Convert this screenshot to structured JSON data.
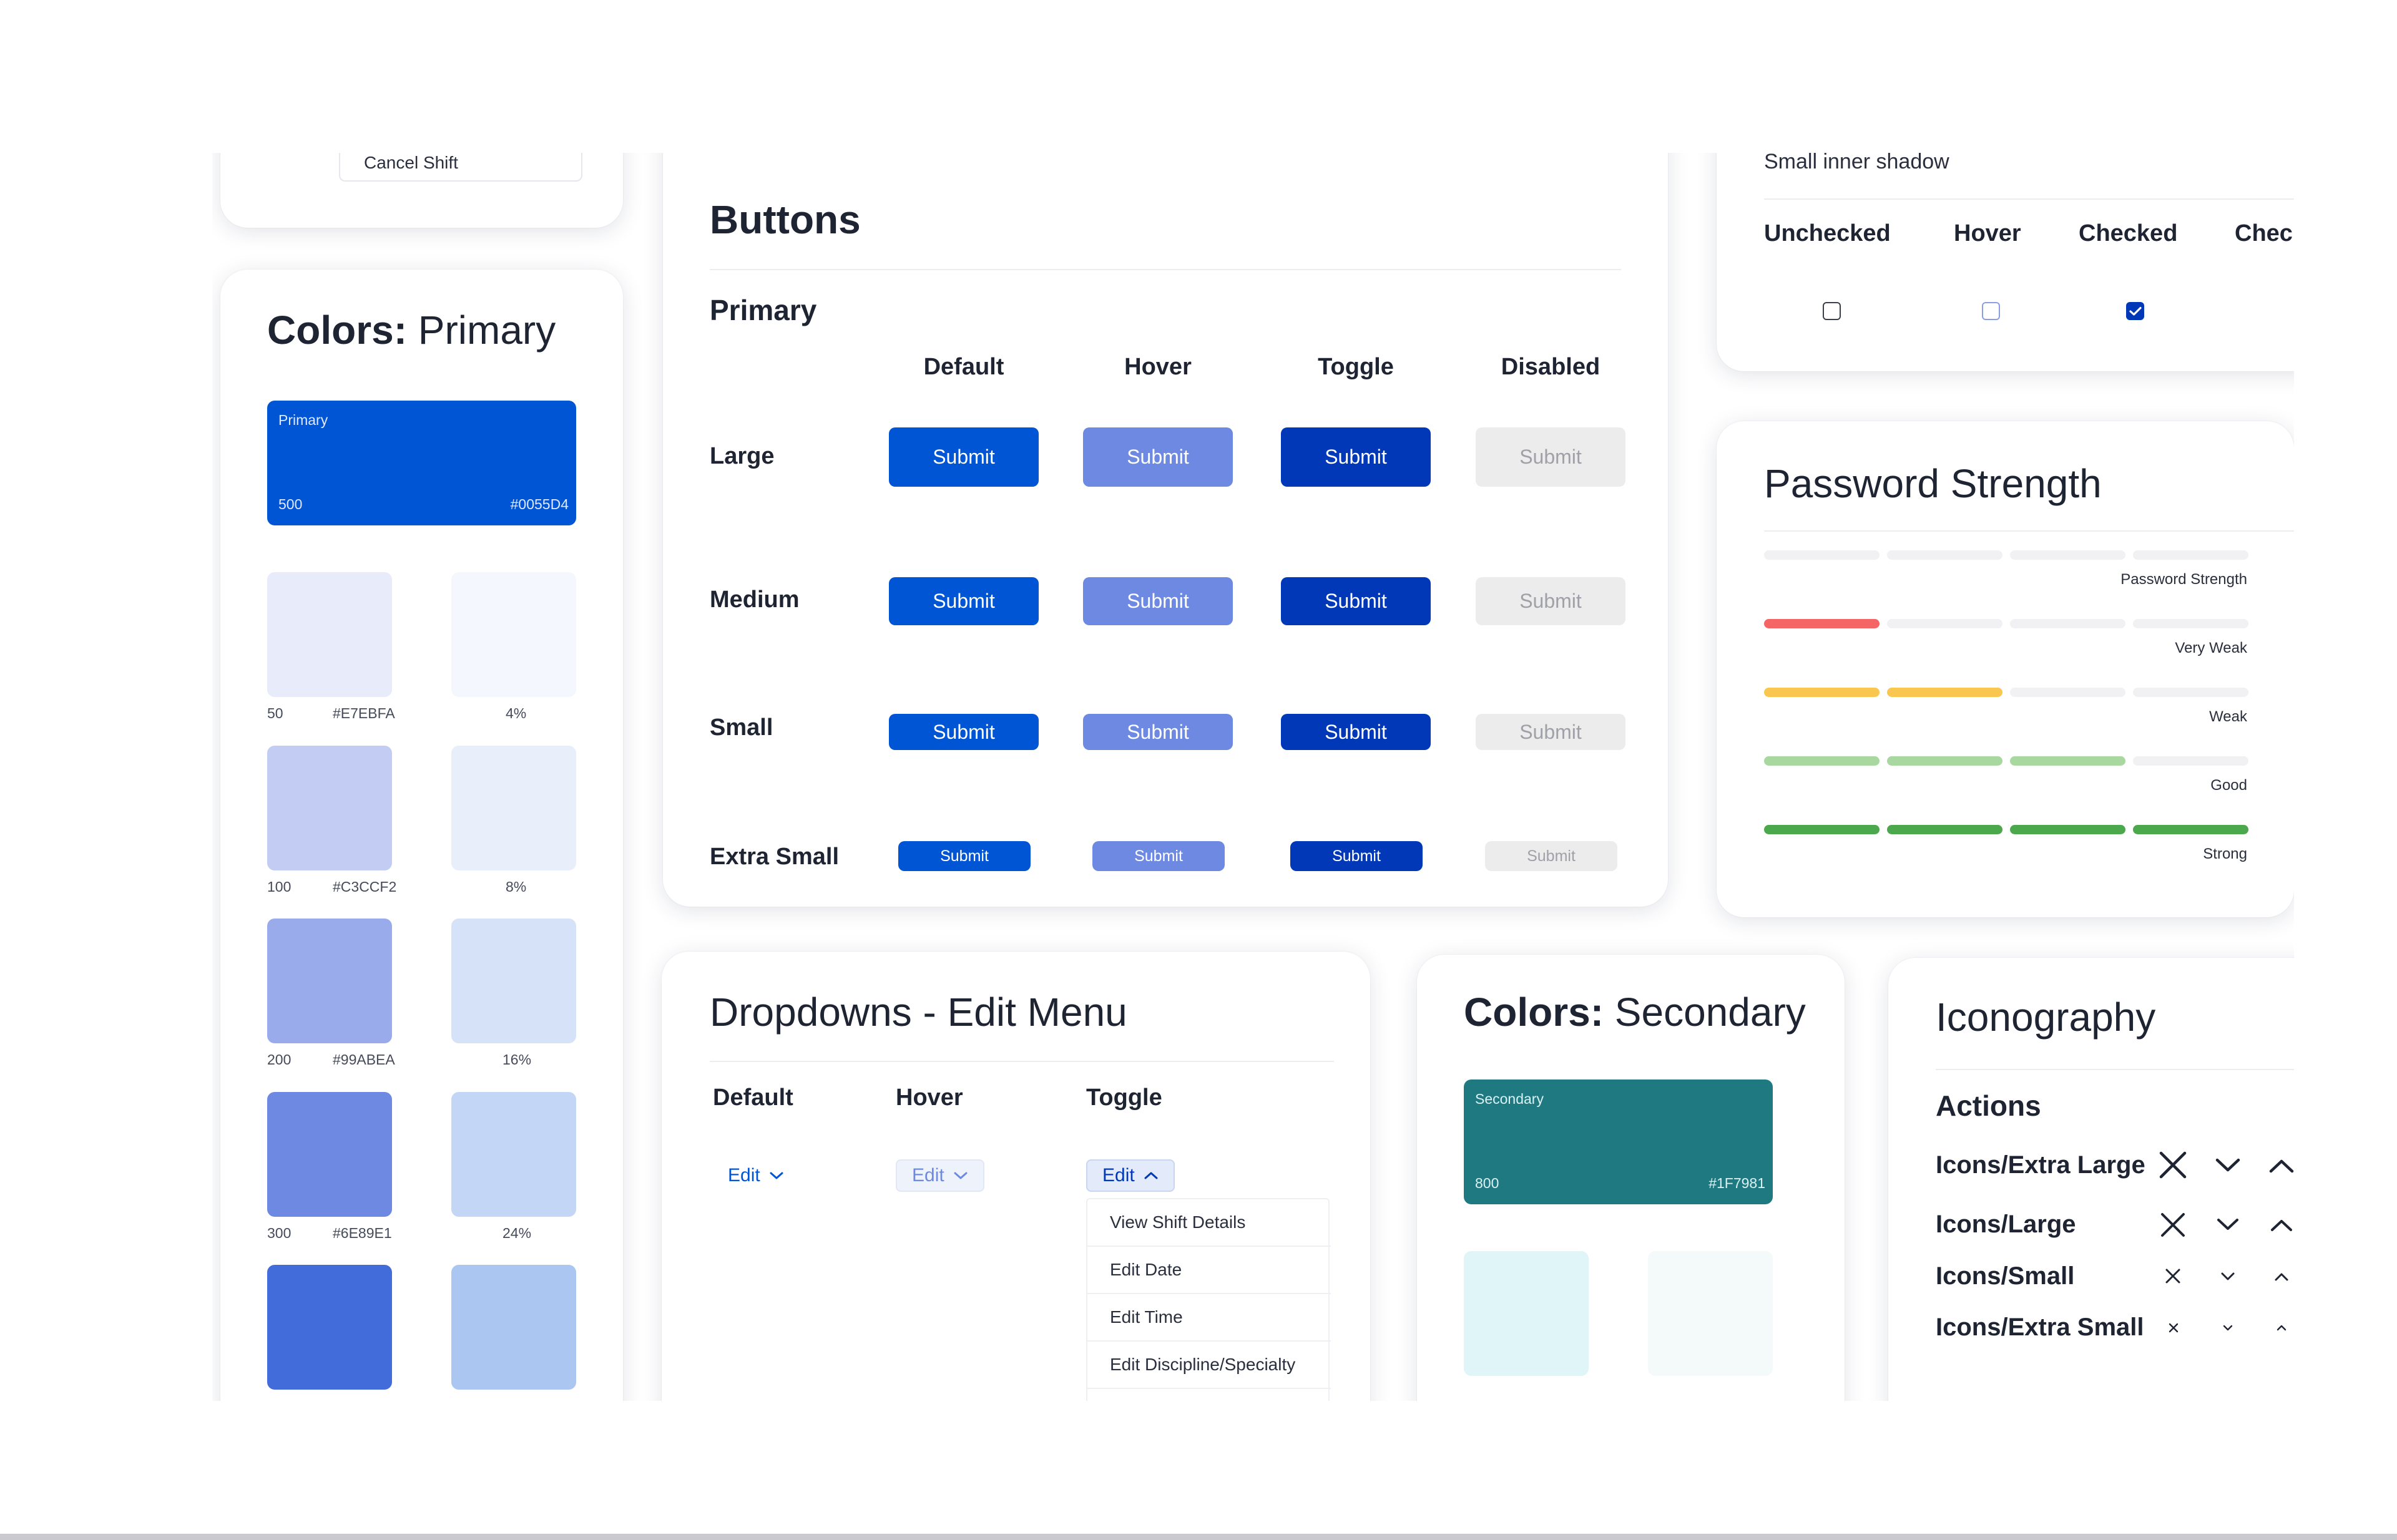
{
  "colors": {
    "primary_500": "#0055D4",
    "secondary_800": "#1F7981",
    "hover": "#6E89E1",
    "toggle": "#0038B8",
    "disabled_bg": "#ECECEC",
    "weak_red": "#F56565",
    "weak_yellow": "#F9C74F",
    "good_green": "#A8D8A0",
    "strong_green": "#4CA84C"
  },
  "top_fragment": {
    "cancel_shift_label": "Cancel Shift"
  },
  "colors_primary": {
    "title_bold": "Colors:",
    "title_light": "Primary",
    "hero": {
      "name": "Primary",
      "shade": "500",
      "hex": "#0055D4"
    },
    "swatches": [
      {
        "shade": "50",
        "hex": "#E7EBFA",
        "tint": "4%"
      },
      {
        "shade": "100",
        "hex": "#C3CCF2",
        "tint": "8%"
      },
      {
        "shade": "200",
        "hex": "#99ABEA",
        "tint": "16%"
      },
      {
        "shade": "300",
        "hex": "#6E89E1",
        "tint": "24%"
      }
    ]
  },
  "buttons": {
    "title": "Buttons",
    "section": "Primary",
    "columns": [
      "Default",
      "Hover",
      "Toggle",
      "Disabled"
    ],
    "rows": [
      "Large",
      "Medium",
      "Small",
      "Extra Small"
    ],
    "button_label": "Submit"
  },
  "checkboxes": {
    "shadow_caption": "Small inner shadow",
    "states": [
      "Unchecked",
      "Hover",
      "Checked",
      "Checked"
    ]
  },
  "password": {
    "title": "Password Strength",
    "levels": [
      "Password Strength",
      "Very Weak",
      "Weak",
      "Good",
      "Strong"
    ]
  },
  "dropdowns": {
    "title": "Dropdowns - Edit Menu",
    "columns": [
      "Default",
      "Hover",
      "Toggle"
    ],
    "trigger_label": "Edit",
    "menu_items": [
      "View Shift Details",
      "Edit Date",
      "Edit Time",
      "Edit Discipline/Specialty"
    ]
  },
  "colors_secondary": {
    "title_bold": "Colors:",
    "title_light": "Secondary",
    "hero": {
      "name": "Secondary",
      "shade": "800",
      "hex": "#1F7981"
    }
  },
  "iconography": {
    "title": "Iconography",
    "section": "Actions",
    "rows": [
      "Icons/Extra Large",
      "Icons/Large",
      "Icons/Small",
      "Icons/Extra Small"
    ],
    "icons": [
      "close-icon",
      "chevron-down-icon",
      "chevron-up-icon"
    ]
  }
}
